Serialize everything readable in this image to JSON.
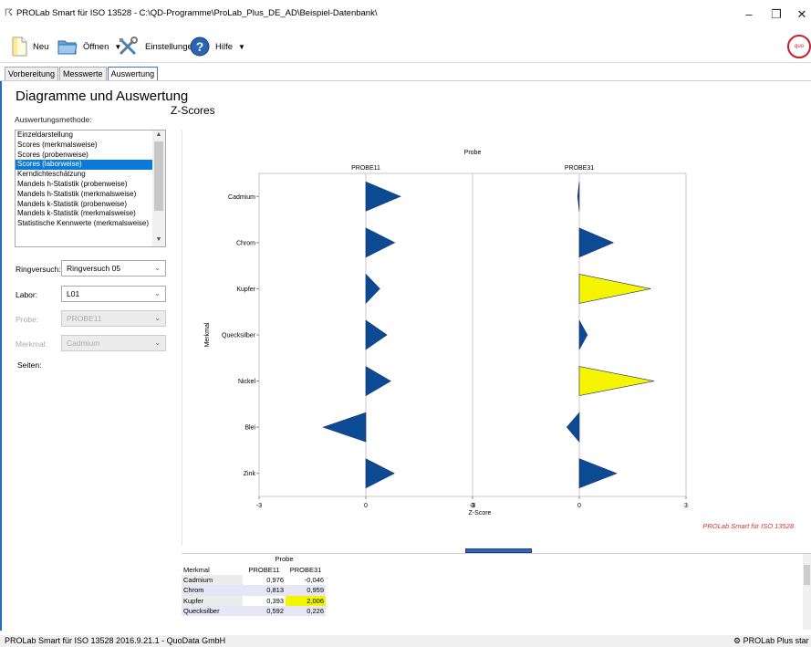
{
  "window": {
    "title": "PROLab Smart für ISO 13528 - C:\\QD-Programme\\ProLab_Plus_DE_AD\\Beispiel-Datenbank\\",
    "minimize": "–",
    "maximize": "❐",
    "close": "✕"
  },
  "toolbar": {
    "new_label": "Neu",
    "open_label": "Öffnen",
    "settings_label": "Einstellungen",
    "help_label": "Hilfe",
    "logo_text": "quo data"
  },
  "tabs": [
    "Vorbereitung",
    "Messwerte",
    "Auswertung"
  ],
  "left": {
    "heading": "Diagramme und Auswertung",
    "method_label": "Auswertungsmethode:",
    "methods": [
      "Einzeldarstellung",
      "Scores (merkmalsweise)",
      "Scores (probenweise)",
      "Scores (laborweise)",
      "Kerndichteschätzung",
      "Mandels h-Statistik (probenweise)",
      "Mandels h-Statistik (merkmalsweise)",
      "Mandels k-Statistik (probenweise)",
      "Mandels k-Statistik (merkmalsweise)",
      "Statistische Kennwerte (merkmalsweise)"
    ],
    "selected_method": "Scores (laborweise)",
    "ringversuch_label": "Ringversuch:",
    "ringversuch_value": "Ringversuch 05",
    "labor_label": "Labor:",
    "labor_value": "L01",
    "probe_label": "Probe:",
    "probe_value": "PROBE11",
    "merkmal_label": "Merkmal:",
    "merkmal_value": "Cadmium",
    "seiten_label": "Seiten:"
  },
  "chart_heading": "Z-Scores",
  "chart_data": {
    "type": "bar",
    "title": "Probe",
    "panels": [
      "PROBE11",
      "PROBE31"
    ],
    "categories": [
      "Cadmium",
      "Chrom",
      "Kupfer",
      "Quecksilber",
      "Nickel",
      "Blei",
      "Zink"
    ],
    "series": [
      {
        "name": "PROBE11",
        "values": [
          0.976,
          0.813,
          0.393,
          0.592,
          0.7,
          -1.2,
          0.8
        ]
      },
      {
        "name": "PROBE31",
        "values": [
          -0.046,
          0.959,
          2.006,
          0.226,
          2.1,
          -0.35,
          1.05
        ]
      }
    ],
    "highlight": [
      [
        false,
        false,
        false,
        false,
        false,
        false,
        false
      ],
      [
        false,
        false,
        true,
        false,
        true,
        false,
        false
      ]
    ],
    "xlabel": "Z-Score",
    "ylabel": "Merkmal",
    "xlim": [
      -3,
      3
    ],
    "xticks": [
      -3,
      0,
      3
    ],
    "xtick_labels": [
      "-3",
      "0",
      "3"
    ],
    "grid": true,
    "watermark": "PROLab Smart für ISO 13528",
    "colors": {
      "normal": "#0c4a93",
      "highlight": "#f5f500",
      "watermark": "#e03030"
    }
  },
  "table": {
    "group_header": "Probe",
    "row_header": "Merkmal",
    "columns": [
      "PROBE11",
      "PROBE31"
    ],
    "rows": [
      {
        "label": "Cadmium",
        "values": [
          "0,976",
          "-0,046"
        ]
      },
      {
        "label": "Chrom",
        "values": [
          "0,813",
          "0,959"
        ]
      },
      {
        "label": "Kupfer",
        "values": [
          "0,393",
          "2,006"
        ]
      },
      {
        "label": "Quecksilber",
        "values": [
          "0,592",
          "0,226"
        ]
      }
    ]
  },
  "status": {
    "left": "PROLab Smart für ISO 13528 2016.9.21.1 - QuoData GmbH",
    "right": "PROLab Plus star"
  }
}
